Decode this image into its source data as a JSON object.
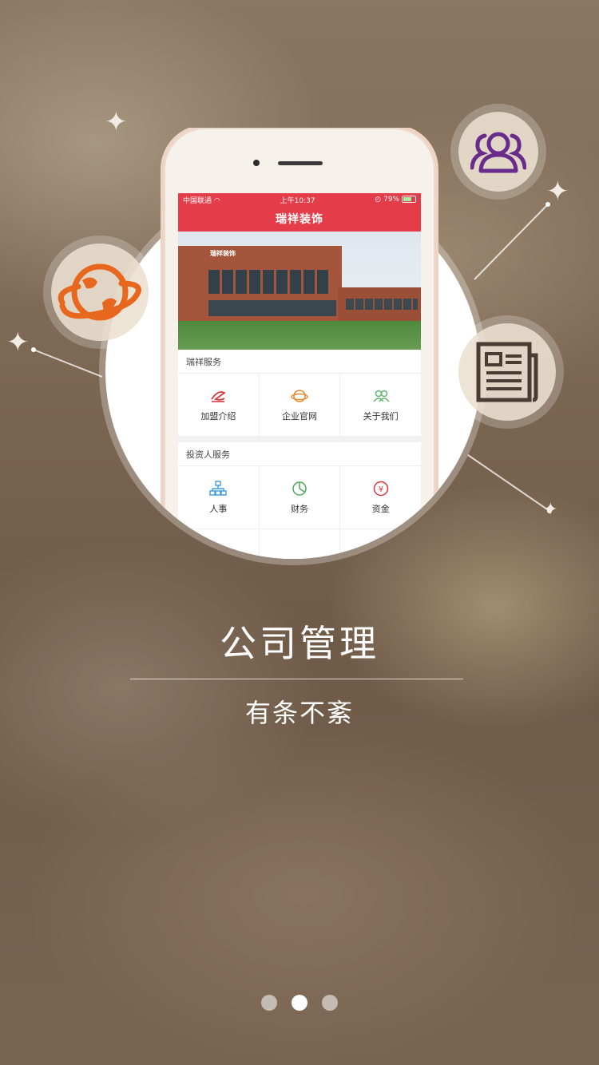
{
  "phone_app": {
    "status_bar": {
      "carrier": "中国联通",
      "time": "上午10:37",
      "battery": "79%"
    },
    "app_title": "瑞祥装饰",
    "banner_sign": "瑞祥装饰",
    "sections": [
      {
        "title": "瑞祥服务",
        "items": [
          {
            "label": "加盟介绍",
            "icon": "join-icon",
            "color": "#d9363e"
          },
          {
            "label": "企业官网",
            "icon": "globe-icon",
            "color": "#e8892c"
          },
          {
            "label": "关于我们",
            "icon": "people-icon",
            "color": "#5fb86a"
          }
        ]
      },
      {
        "title": "投资人服务",
        "items": [
          {
            "label": "人事",
            "icon": "org-chart-icon",
            "color": "#3d9be0"
          },
          {
            "label": "财务",
            "icon": "pie-chart-icon",
            "color": "#4aa85a"
          },
          {
            "label": "资金",
            "icon": "yen-icon",
            "color": "#d9363e"
          }
        ]
      }
    ]
  },
  "feature": {
    "title": "公司管理",
    "subtitle": "有条不紊"
  },
  "pager": {
    "count": 3,
    "active_index": 1
  },
  "colors": {
    "brand_red": "#e43c49",
    "globe_orange": "#e8671f",
    "people_purple": "#6a2c8a",
    "news_brown": "#4a3b33"
  }
}
